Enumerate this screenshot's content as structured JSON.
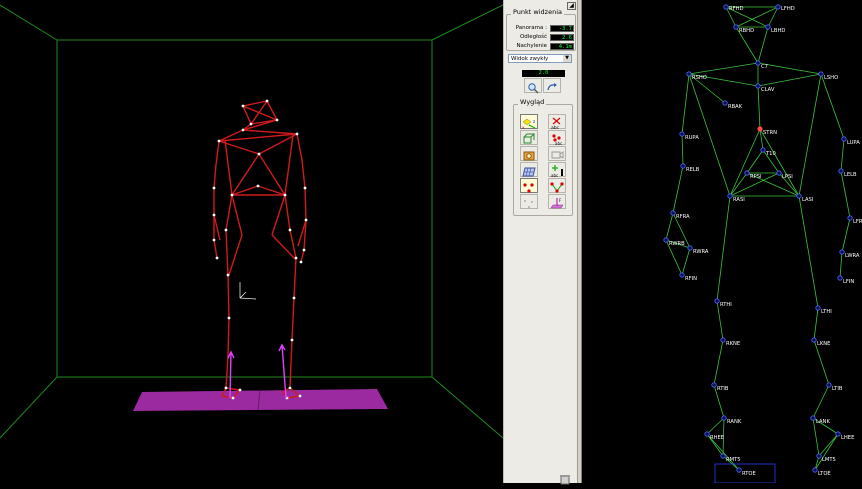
{
  "colors": {
    "skeleton_3d": "#e01b1b",
    "skeleton_2d": "#3cc43c",
    "marker_2d": "#3d5cff",
    "room": "#1f8a1f",
    "plate": "#9b2aa0"
  },
  "panel": {
    "viewpoint_title": "Punkt widzenia",
    "pan_label": "Panorama :",
    "pan_value": "-3.7",
    "dist_label": "Odległość",
    "dist_value": "2.6",
    "tilt_label": "Nachylenie",
    "tilt_value": "4.1m",
    "view_select": "Widok zwykły",
    "zoom_value": "2.0",
    "appearance_title": "Wygląd"
  },
  "markers_2d": {
    "RFHD": "RFHD",
    "LFHD": "LFHD",
    "RBHD": "RBHD",
    "LBHD": "LBHD",
    "C7": "C7",
    "CLAV": "CLAV",
    "RSHO": "RSHO",
    "LSHO": "LSHO",
    "RBAK": "RBAK",
    "STRN": "STRN",
    "T10": "T10",
    "RUPA": "RUPA",
    "LUPA": "LUPA",
    "RELB": "RELB",
    "LELB": "LELB",
    "RPSI": "RPSI",
    "LPSI": "LPSI",
    "RASI": "RASI",
    "LASI": "LASI",
    "RFRA": "RFRA",
    "LFRA": "LFRA",
    "RWRB": "RWRB",
    "RWRA": "RWRA",
    "LWRA": "LWRA",
    "RFIN": "RFIN",
    "LFIN": "LFIN",
    "RTHI": "RTHI",
    "LTHI": "LTHI",
    "RKNE": "RKNE",
    "LKNE": "LKNE",
    "RTIB": "RTIB",
    "LTIB": "LTIB",
    "RANK": "RANK",
    "LANK": "LANK",
    "RHEE": "RHEE",
    "LHEE": "LHEE",
    "RMT5": "RMT5",
    "LMT5": "LMT5",
    "RTOE": "RTOE",
    "LTOE": "LTOE"
  }
}
